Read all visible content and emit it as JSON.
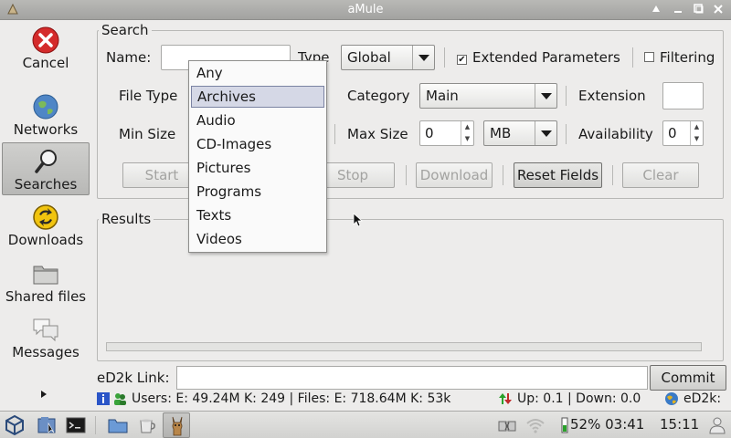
{
  "window": {
    "title": "aMule"
  },
  "sidebar": {
    "items": [
      {
        "label": "Cancel"
      },
      {
        "label": "Networks"
      },
      {
        "label": "Searches"
      },
      {
        "label": "Downloads"
      },
      {
        "label": "Shared files"
      },
      {
        "label": "Messages"
      }
    ]
  },
  "search": {
    "group_title": "Search",
    "name_label": "Name:",
    "name_value": "",
    "type_label": "Type",
    "type_value": "Global",
    "extended_label": "Extended Parameters",
    "extended_checked": true,
    "filtering_label": "Filtering",
    "filtering_checked": false,
    "file_type_label": "File Type",
    "category_label": "Category",
    "category_value": "Main",
    "extension_label": "Extension",
    "extension_value": "",
    "min_size_label": "Min Size",
    "max_size_label": "Max Size",
    "max_size_value": "0",
    "max_unit_value": "MB",
    "availability_label": "Availability",
    "availability_value": "0",
    "buttons": {
      "start": "Start",
      "stop": "Stop",
      "download": "Download",
      "reset": "Reset Fields",
      "clear": "Clear"
    }
  },
  "file_type_dropdown": {
    "options": [
      "Any",
      "Archives",
      "Audio",
      "CD-Images",
      "Pictures",
      "Programs",
      "Texts",
      "Videos"
    ],
    "highlighted": "Archives"
  },
  "results": {
    "group_title": "Results"
  },
  "ed2k": {
    "label": "eD2k Link:",
    "value": "",
    "commit": "Commit"
  },
  "status_bar": {
    "users": "Users: E: 49.24M K: 249 | Files: E: 718.64M K: 53k",
    "transfer": "Up: 0.1 | Down: 0.0",
    "network": "eD2k:"
  },
  "taskbar": {
    "battery": "52% 03:41",
    "clock": "15:11"
  },
  "colors": {
    "background": "#edeceb",
    "highlight": "#d5d8e6",
    "titlebar": "#a2a2a0",
    "cancel_red": "#d42b2b"
  }
}
